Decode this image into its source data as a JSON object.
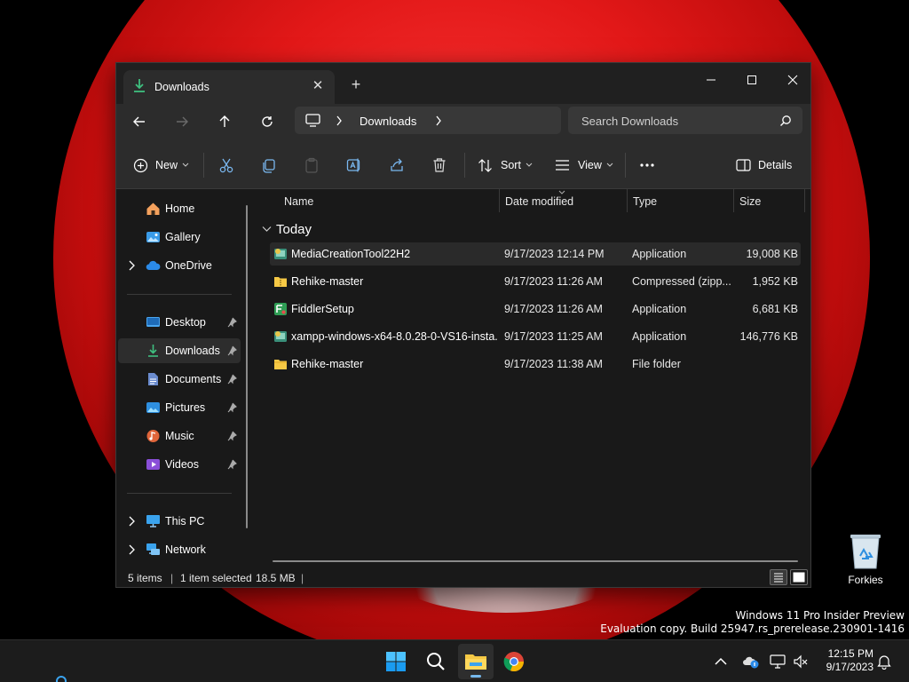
{
  "window": {
    "tab_title": "Downloads",
    "address_crumb": "Downloads",
    "search_placeholder": "Search Downloads"
  },
  "toolbar": {
    "new_label": "New",
    "sort_label": "Sort",
    "view_label": "View",
    "details_label": "Details"
  },
  "sidebar": {
    "items": [
      {
        "label": "Home",
        "icon": "home-icon"
      },
      {
        "label": "Gallery",
        "icon": "gallery-icon"
      },
      {
        "label": "OneDrive",
        "icon": "onedrive-icon"
      },
      {
        "label": "Desktop",
        "icon": "desktop-icon"
      },
      {
        "label": "Downloads",
        "icon": "downloads-icon"
      },
      {
        "label": "Documents",
        "icon": "documents-icon"
      },
      {
        "label": "Pictures",
        "icon": "pictures-icon"
      },
      {
        "label": "Music",
        "icon": "music-icon"
      },
      {
        "label": "Videos",
        "icon": "videos-icon"
      },
      {
        "label": "This PC",
        "icon": "this-pc-icon"
      },
      {
        "label": "Network",
        "icon": "network-icon"
      }
    ]
  },
  "columns": {
    "name": "Name",
    "date": "Date modified",
    "type": "Type",
    "size": "Size"
  },
  "group": "Today",
  "files": [
    {
      "name": "MediaCreationTool22H2",
      "date": "9/17/2023 12:14 PM",
      "type": "Application",
      "size": "19,008 KB",
      "icon": "application-icon"
    },
    {
      "name": "Rehike-master",
      "date": "9/17/2023 11:26 AM",
      "type": "Compressed (zipp...",
      "size": "1,952 KB",
      "icon": "zip-folder-icon"
    },
    {
      "name": "FiddlerSetup",
      "date": "9/17/2023 11:26 AM",
      "type": "Application",
      "size": "6,681 KB",
      "icon": "application-icon"
    },
    {
      "name": "xampp-windows-x64-8.0.28-0-VS16-insta...",
      "date": "9/17/2023 11:25 AM",
      "type": "Application",
      "size": "146,776 KB",
      "icon": "application-icon"
    },
    {
      "name": "Rehike-master",
      "date": "9/17/2023 11:38 AM",
      "type": "File folder",
      "size": "",
      "icon": "folder-icon"
    }
  ],
  "status": {
    "items": "5 items",
    "selected": "1 item selected",
    "size": "18.5 MB"
  },
  "desktop": {
    "recycle_label": "Forkies",
    "watermark_line1": "Windows 11 Pro Insider Preview",
    "watermark_line2": "Evaluation copy. Build 25947.rs_prerelease.230901-1416"
  },
  "taskbar": {
    "time": "12:15 PM",
    "date": "9/17/2023"
  },
  "colors": {
    "accent": "#76b9ed",
    "folder": "#f6c945",
    "window_bg": "#191919",
    "toolbar_bg": "#2c2c2c"
  }
}
